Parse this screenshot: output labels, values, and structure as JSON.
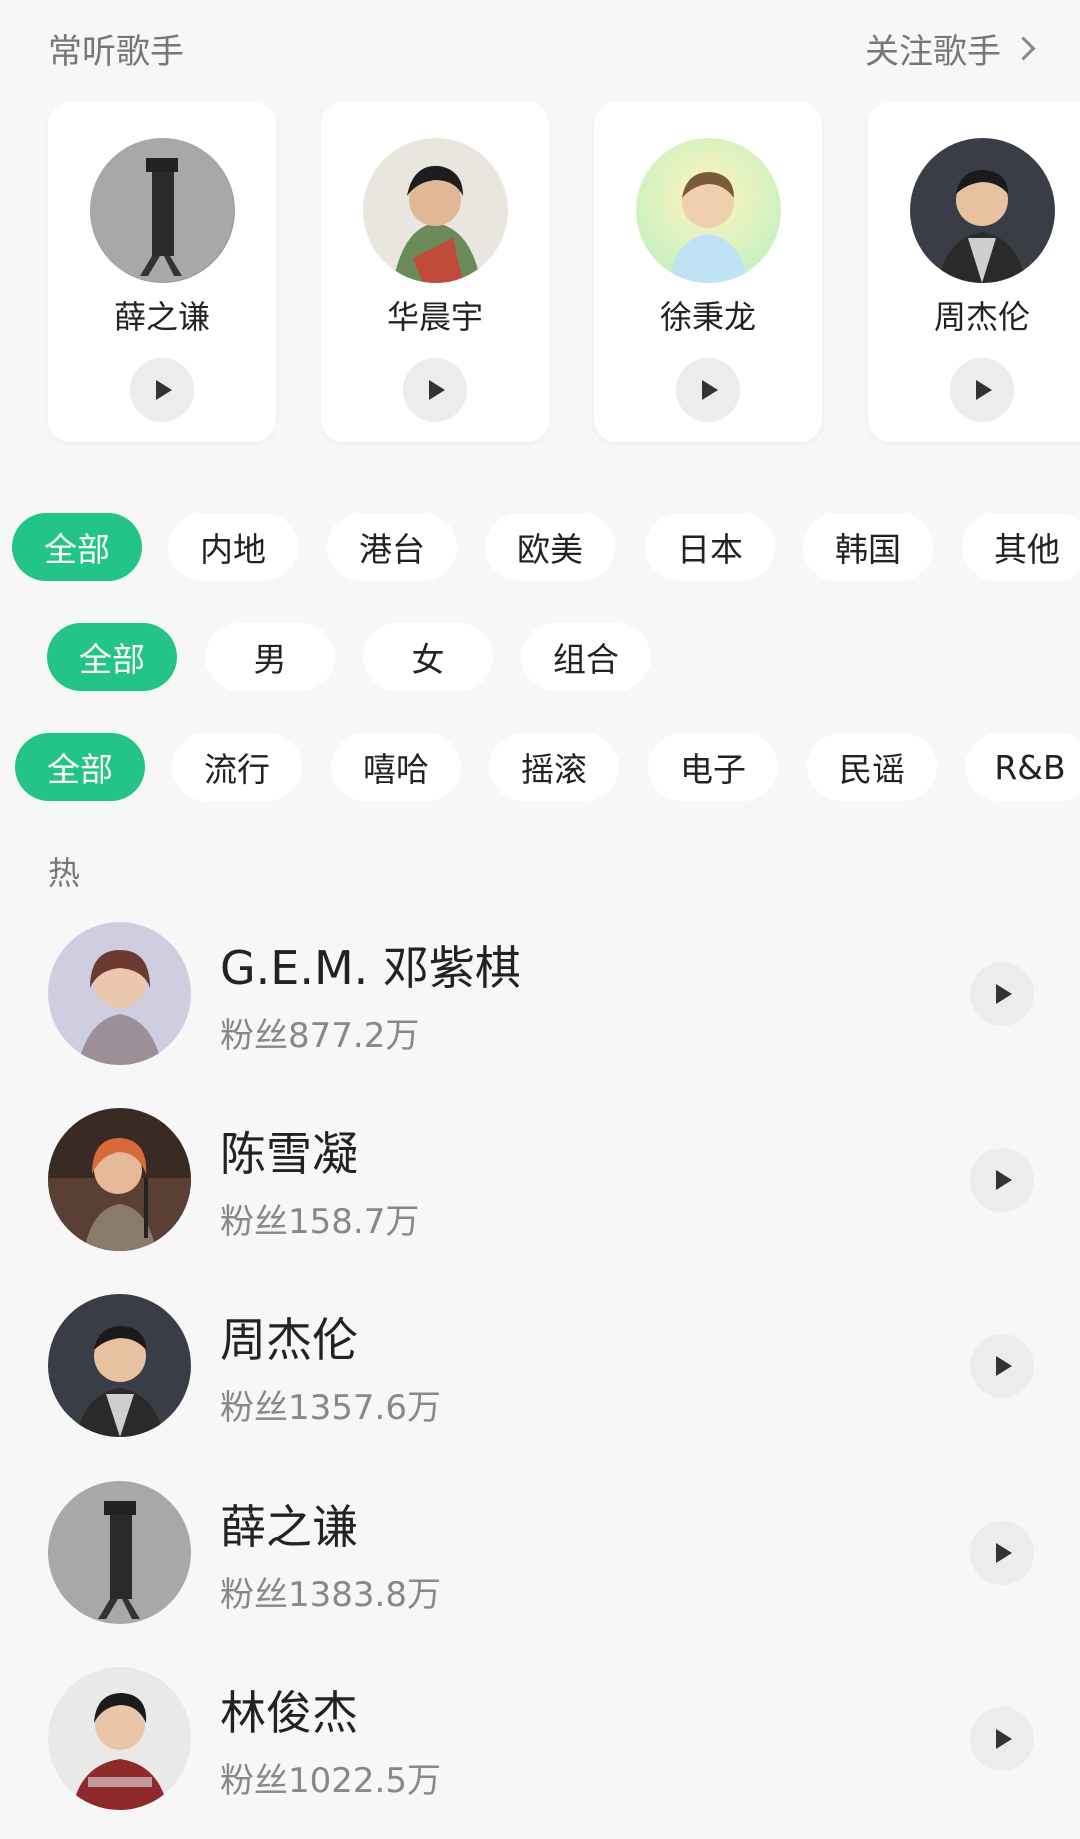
{
  "header": {
    "title": "常听歌手",
    "follow_link": "关注歌手"
  },
  "recent_artists": [
    {
      "name": "薛之谦"
    },
    {
      "name": "华晨宇"
    },
    {
      "name": "徐秉龙"
    },
    {
      "name": "周杰伦"
    }
  ],
  "filters": {
    "region": [
      "全部",
      "内地",
      "港台",
      "欧美",
      "日本",
      "韩国",
      "其他"
    ],
    "gender": [
      "全部",
      "男",
      "女",
      "组合"
    ],
    "genre": [
      "全部",
      "流行",
      "嘻哈",
      "摇滚",
      "电子",
      "民谣",
      "R&B"
    ]
  },
  "section": {
    "label": "热"
  },
  "artists": [
    {
      "name": "G.E.M. 邓紫棋",
      "fans": "粉丝877.2万"
    },
    {
      "name": "陈雪凝",
      "fans": "粉丝158.7万"
    },
    {
      "name": "周杰伦",
      "fans": "粉丝1357.6万"
    },
    {
      "name": "薛之谦",
      "fans": "粉丝1383.8万"
    },
    {
      "name": "林俊杰",
      "fans": "粉丝1022.5万"
    }
  ],
  "colors": {
    "accent": "#22c488",
    "background": "#f7f7f7"
  }
}
